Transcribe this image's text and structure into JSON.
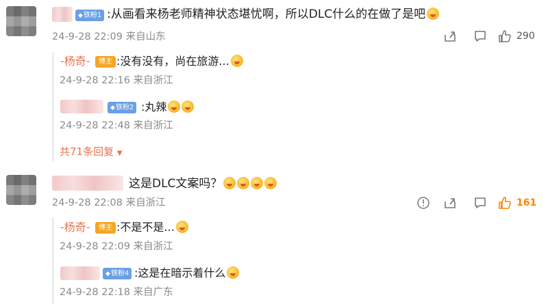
{
  "comments": [
    {
      "badge": "铁粉1",
      "text": ":从画看来杨老师精神状态堪忧啊，所以DLC什么的在做了是吧",
      "emojis": [
        "cat-face"
      ],
      "meta": "24-9-28 22:09 来自山东",
      "like_count": "290",
      "replies": [
        {
          "author": "-杨奇-",
          "badge": "博主",
          "text": ":没有没有，尚在旅游...",
          "emojis": [
            "smile-tongue"
          ],
          "meta": "24-9-28 22:16 来自浙江"
        },
        {
          "badge": "铁粉2",
          "text": ":丸辣",
          "emojis": [
            "worried",
            "crying"
          ],
          "meta": "24-9-28 22:48 来自浙江"
        }
      ],
      "more_replies": "共71条回复"
    },
    {
      "text": "这是DLC文案吗？",
      "emojis": [
        "thinking",
        "thinking",
        "thinking",
        "thinking"
      ],
      "meta": "24-9-28 22:08 来自浙江",
      "like_count": "161",
      "replies": [
        {
          "author": "-杨奇-",
          "badge": "博主",
          "text": ":不是不是...",
          "emojis": [
            "smile-tongue"
          ],
          "meta": "24-9-28 22:09 来自浙江"
        },
        {
          "badge": "铁粉4",
          "text": ":这是在暗示着什么",
          "emojis": [
            "sweat"
          ],
          "meta": "24-9-28 22:18 来自广东"
        }
      ]
    }
  ],
  "colors": {
    "author": "#eb7350",
    "host_badge": "#f5a623",
    "fan_badge": "#6b9fe6",
    "like_active": "#ff8200",
    "meta": "#8a8a8a"
  },
  "icons": [
    "share-icon",
    "comment-icon",
    "like-icon"
  ]
}
